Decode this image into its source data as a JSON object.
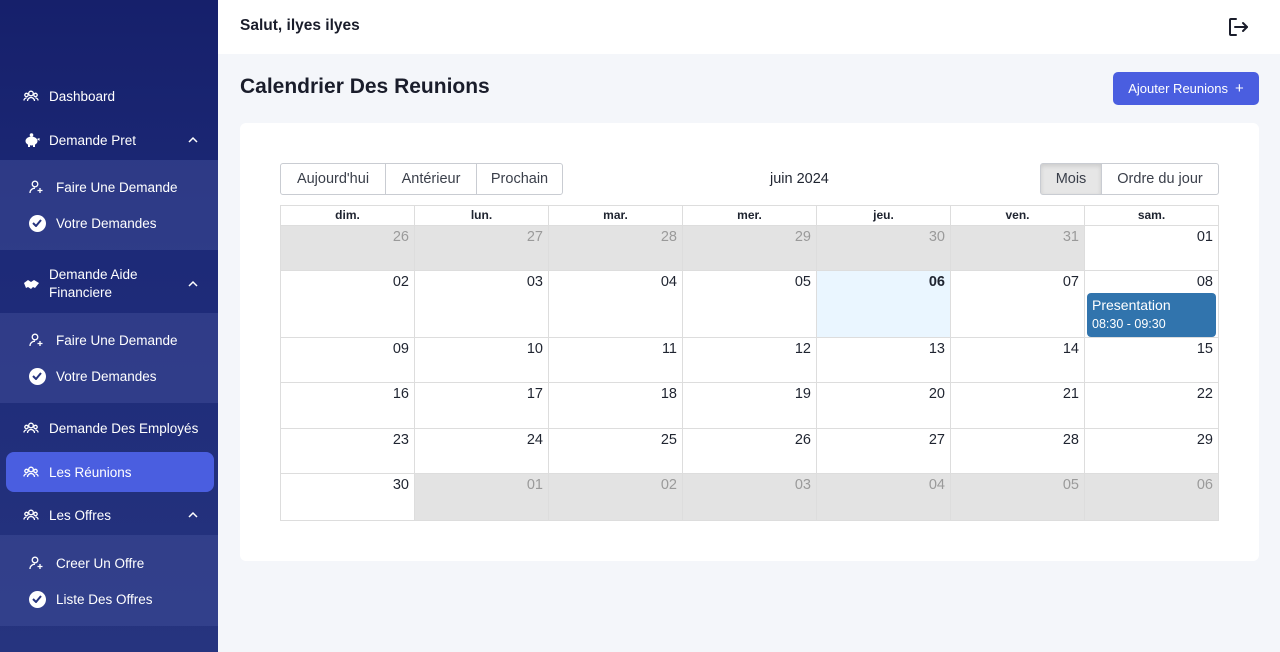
{
  "header": {
    "greeting": "Salut, ilyes ilyes"
  },
  "sidebar": {
    "dashboard": "Dashboard",
    "demande_pret": {
      "label": "Demande Pret",
      "sub": [
        "Faire Une Demande",
        "Votre Demandes"
      ]
    },
    "demande_aide": {
      "label": "Demande Aide Financiere",
      "sub": [
        "Faire Une Demande",
        "Votre Demandes"
      ]
    },
    "demande_employes": "Demande Des Employés",
    "reunions": "Les Réunions",
    "offres": {
      "label": "Les Offres",
      "sub": [
        "Creer Un Offre",
        "Liste Des Offres"
      ]
    }
  },
  "page": {
    "title": "Calendrier Des Reunions",
    "add_button": "Ajouter Reunions"
  },
  "calendar": {
    "nav": {
      "today": "Aujourd'hui",
      "prev": "Antérieur",
      "next": "Prochain"
    },
    "label": "juin 2024",
    "views": {
      "month": "Mois",
      "agenda": "Ordre du jour"
    },
    "active_view": "Mois",
    "weekdays": [
      "dim.",
      "lun.",
      "mar.",
      "mer.",
      "jeu.",
      "ven.",
      "sam."
    ],
    "weeks": [
      [
        {
          "d": "26",
          "off": true
        },
        {
          "d": "27",
          "off": true
        },
        {
          "d": "28",
          "off": true
        },
        {
          "d": "29",
          "off": true
        },
        {
          "d": "30",
          "off": true
        },
        {
          "d": "31",
          "off": true
        },
        {
          "d": "01"
        }
      ],
      [
        {
          "d": "02"
        },
        {
          "d": "03"
        },
        {
          "d": "04"
        },
        {
          "d": "05"
        },
        {
          "d": "06",
          "today": true
        },
        {
          "d": "07"
        },
        {
          "d": "08",
          "event": {
            "title": "Presentation",
            "time": "08:30 - 09:30"
          }
        }
      ],
      [
        {
          "d": "09"
        },
        {
          "d": "10"
        },
        {
          "d": "11"
        },
        {
          "d": "12"
        },
        {
          "d": "13"
        },
        {
          "d": "14"
        },
        {
          "d": "15"
        }
      ],
      [
        {
          "d": "16"
        },
        {
          "d": "17"
        },
        {
          "d": "18"
        },
        {
          "d": "19"
        },
        {
          "d": "20"
        },
        {
          "d": "21"
        },
        {
          "d": "22"
        }
      ],
      [
        {
          "d": "23"
        },
        {
          "d": "24"
        },
        {
          "d": "25"
        },
        {
          "d": "26"
        },
        {
          "d": "27"
        },
        {
          "d": "28"
        },
        {
          "d": "29"
        }
      ],
      [
        {
          "d": "30"
        },
        {
          "d": "01",
          "off": true
        },
        {
          "d": "02",
          "off": true
        },
        {
          "d": "03",
          "off": true
        },
        {
          "d": "04",
          "off": true
        },
        {
          "d": "05",
          "off": true
        },
        {
          "d": "06",
          "off": true
        }
      ]
    ]
  },
  "colors": {
    "sidebar": "#1a2470",
    "accent": "#4a5ee0",
    "event": "#3174ad",
    "today": "#eaf6ff",
    "off_day": "#e3e3e3"
  }
}
